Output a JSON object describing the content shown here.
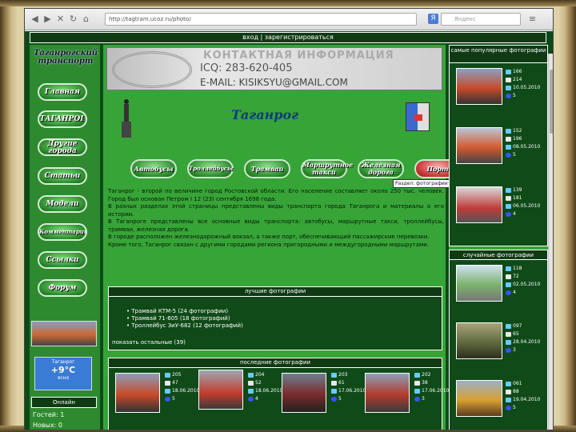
{
  "browser": {
    "address": "http://tagtram.ucoz.ru/photo/",
    "search_placeholder": "Яндекс"
  },
  "topbar": {
    "text": "вход | зарегистрироваться"
  },
  "left": {
    "logo": "Таганрогский транспорт",
    "nav": [
      "Главная",
      "ТАГАНРОГ",
      "Другие города",
      "Статьи",
      "Модели",
      "Комментарии",
      "Ссылки",
      "Форум"
    ],
    "weather": {
      "city": "Таганрог",
      "temp": "+9°C",
      "note": "ясно"
    },
    "online_title": "Онлайн",
    "online_lines": [
      "Гостей: 1",
      "Новых: 0"
    ]
  },
  "banner": {
    "title": "КОНТАКТНАЯ ИНФОРМАЦИЯ",
    "icq": "ICQ: 283-620-405",
    "email": "E-MAIL: KISIKSYU@GMAIL.COM"
  },
  "city_title": "Таганрог",
  "transport_tabs": [
    "Автобусы",
    "Троллейбусы",
    "Трамваи",
    "Маршрутное такси",
    "Железная дорога",
    "Порт"
  ],
  "tooltip": "Раздел: фотографии Таганрога",
  "description": [
    "Таганрог - второй по величине город Ростовской области. Его население составляет около 250 тыс. человек. Город был основан Петром I 12 (23) сентября 1698 года.",
    "В разных разделах этой страницы представлены виды транспорта города Таганрога и материалы о его истории.",
    "В Таганроге представлены все основные виды транспорта: автобусы, маршрутные такси, троллейбусы, трамваи, железная дорога.",
    "В городе расположен железнодорожный вокзал, а также порт, обеспечивающий пассажирские перевозки.",
    "Кроме того, Таганрог связан с другими городами региона пригородными и междугородными маршрутами."
  ],
  "best_photos": {
    "title": "лучшие фотографии",
    "items": [
      "Трамвай КТМ-5 (24 фотографии)",
      "Трамвай 71-605 (18 фотографий)",
      "Троллейбус ЗиУ-682 (12 фотографий)"
    ],
    "more": "показать остальные (39)"
  },
  "recent_photos": {
    "title": "последние фотографии",
    "items": [
      {
        "id": "205",
        "views": "47",
        "comments": "0",
        "date": "18.06.2010",
        "rating": "5"
      },
      {
        "id": "204",
        "views": "52",
        "comments": "0",
        "date": "18.06.2010",
        "rating": "4"
      },
      {
        "id": "203",
        "views": "61",
        "comments": "1",
        "date": "17.06.2010",
        "rating": "5"
      },
      {
        "id": "202",
        "views": "38",
        "comments": "0",
        "date": "17.06.2010",
        "rating": "3"
      }
    ]
  },
  "popular": {
    "title": "самые популярные фотографии",
    "items": [
      {
        "id": "166",
        "views": "214",
        "comments": "3",
        "date": "10.05.2010",
        "rating": "5"
      },
      {
        "id": "152",
        "views": "196",
        "comments": "2",
        "date": "08.05.2010",
        "rating": "5"
      },
      {
        "id": "139",
        "views": "181",
        "comments": "1",
        "date": "06.05.2010",
        "rating": "4"
      }
    ]
  },
  "random": {
    "title": "случайные фотографии",
    "items": [
      {
        "id": "118",
        "views": "72",
        "comments": "0",
        "date": "02.05.2010",
        "rating": "4"
      },
      {
        "id": "097",
        "views": "65",
        "comments": "0",
        "date": "28.04.2010",
        "rating": "3"
      },
      {
        "id": "061",
        "views": "88",
        "comments": "1",
        "date": "19.04.2010",
        "rating": "5"
      }
    ]
  }
}
